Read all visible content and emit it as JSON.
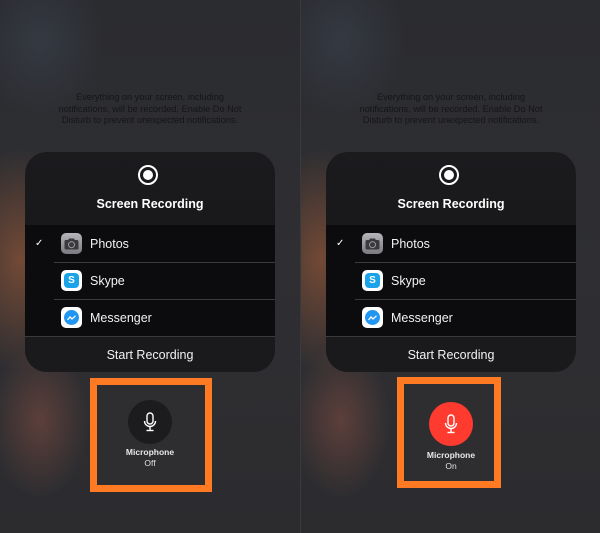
{
  "panels": [
    {
      "notice": "Everything on your screen, including notifications, will be recorded. Enable Do Not Disturb to prevent unexpected notifications.",
      "title": "Screen Recording",
      "record_icon": "record-icon",
      "apps": [
        {
          "label": "Photos",
          "icon": "camera-icon",
          "checked": "✓"
        },
        {
          "label": "Skype",
          "icon": "skype-icon",
          "checked": ""
        },
        {
          "label": "Messenger",
          "icon": "messenger-icon",
          "checked": ""
        }
      ],
      "start_label": "Start Recording",
      "microphone": {
        "label": "Microphone",
        "state": "Off",
        "color": "#1c1c1e"
      }
    },
    {
      "notice": "Everything on your screen, including notifications, will be recorded. Enable Do Not Disturb to prevent unexpected notifications.",
      "title": "Screen Recording",
      "record_icon": "record-icon",
      "apps": [
        {
          "label": "Photos",
          "icon": "camera-icon",
          "checked": "✓"
        },
        {
          "label": "Skype",
          "icon": "skype-icon",
          "checked": ""
        },
        {
          "label": "Messenger",
          "icon": "messenger-icon",
          "checked": ""
        }
      ],
      "start_label": "Start Recording",
      "microphone": {
        "label": "Microphone",
        "state": "On",
        "color": "#ff3b30"
      }
    }
  ],
  "skype_glyph": "S",
  "highlight_color": "#ff7a22"
}
